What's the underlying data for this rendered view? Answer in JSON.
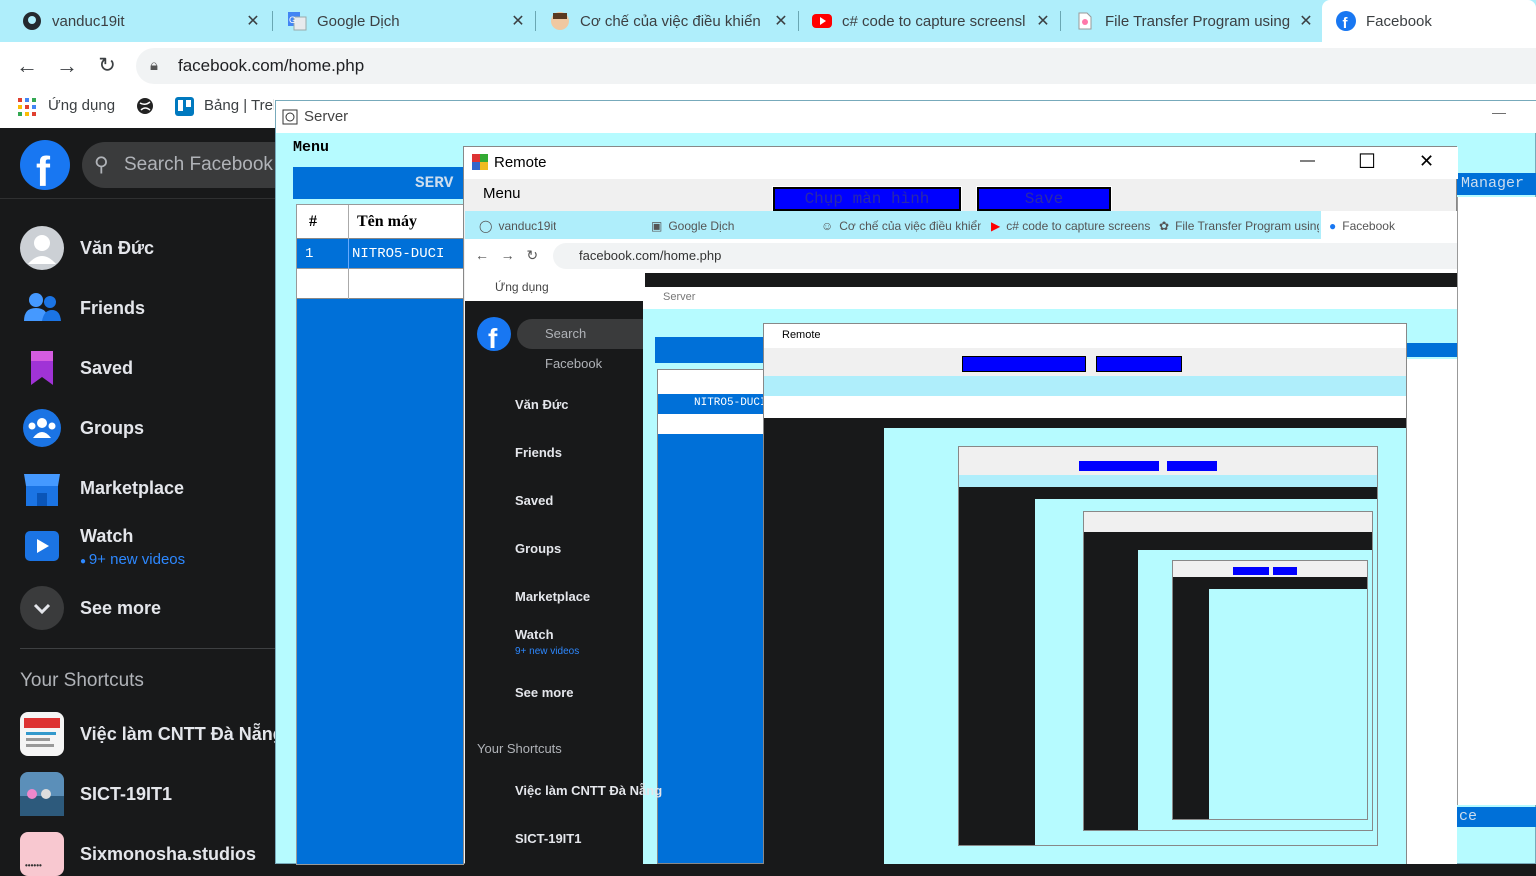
{
  "browser": {
    "tabs": [
      {
        "title": "vanduc19it",
        "icon": "github-icon"
      },
      {
        "title": "Google Dịch",
        "icon": "google-translate-icon"
      },
      {
        "title": "Cơ chế của việc điều khiển",
        "icon": "avatar-icon"
      },
      {
        "title": "c# code to capture screensl",
        "icon": "youtube-icon"
      },
      {
        "title": "File Transfer Program using",
        "icon": "file-icon"
      },
      {
        "title": "Facebook",
        "icon": "facebook-icon"
      }
    ],
    "url": "facebook.com/home.php",
    "bookmarks": [
      {
        "label": "Ứng dụng",
        "icon": "apps-grid-icon"
      },
      {
        "label": "",
        "icon": "globe-icon"
      },
      {
        "label": "Bảng | Trel",
        "icon": "trello-icon"
      }
    ]
  },
  "facebook": {
    "search_placeholder": "Search Facebook",
    "nav": [
      {
        "label": "Văn Đức",
        "icon": "profile-avatar-icon"
      },
      {
        "label": "Friends",
        "icon": "friends-icon"
      },
      {
        "label": "Saved",
        "icon": "saved-bookmark-icon"
      },
      {
        "label": "Groups",
        "icon": "groups-icon"
      },
      {
        "label": "Marketplace",
        "icon": "marketplace-icon"
      },
      {
        "label": "Watch",
        "icon": "watch-icon",
        "sub": "9+ new videos"
      },
      {
        "label": "See more",
        "icon": "chevron-down-icon"
      }
    ],
    "shortcuts_title": "Your Shortcuts",
    "shortcuts": [
      {
        "label": "Việc làm CNTT Đà Nẵng"
      },
      {
        "label": "SICT-19IT1"
      },
      {
        "label": "Sixmonosha.studios"
      }
    ]
  },
  "server": {
    "title": "Server",
    "menu": "Menu",
    "header_text": "SERV",
    "right_header": "Manager",
    "bottom_right": "ce",
    "table": {
      "columns": [
        "#",
        "Tên máy"
      ],
      "rows": [
        [
          "1",
          "NITRO5-DUCI"
        ]
      ]
    }
  },
  "remote": {
    "title": "Remote",
    "menu": "Menu",
    "capture_button": "Chụp màn hình",
    "save_button": "Save",
    "controls": {
      "minimize": "—",
      "maximize": "☐",
      "close": "✕"
    }
  },
  "colors": {
    "tab_bar": "#afeefb",
    "server_bg": "#b6fbff",
    "table_blue": "#0070d8",
    "button_blue": "#0000ff",
    "facebook_dark": "#18191a",
    "facebook_blue": "#1877f2"
  }
}
